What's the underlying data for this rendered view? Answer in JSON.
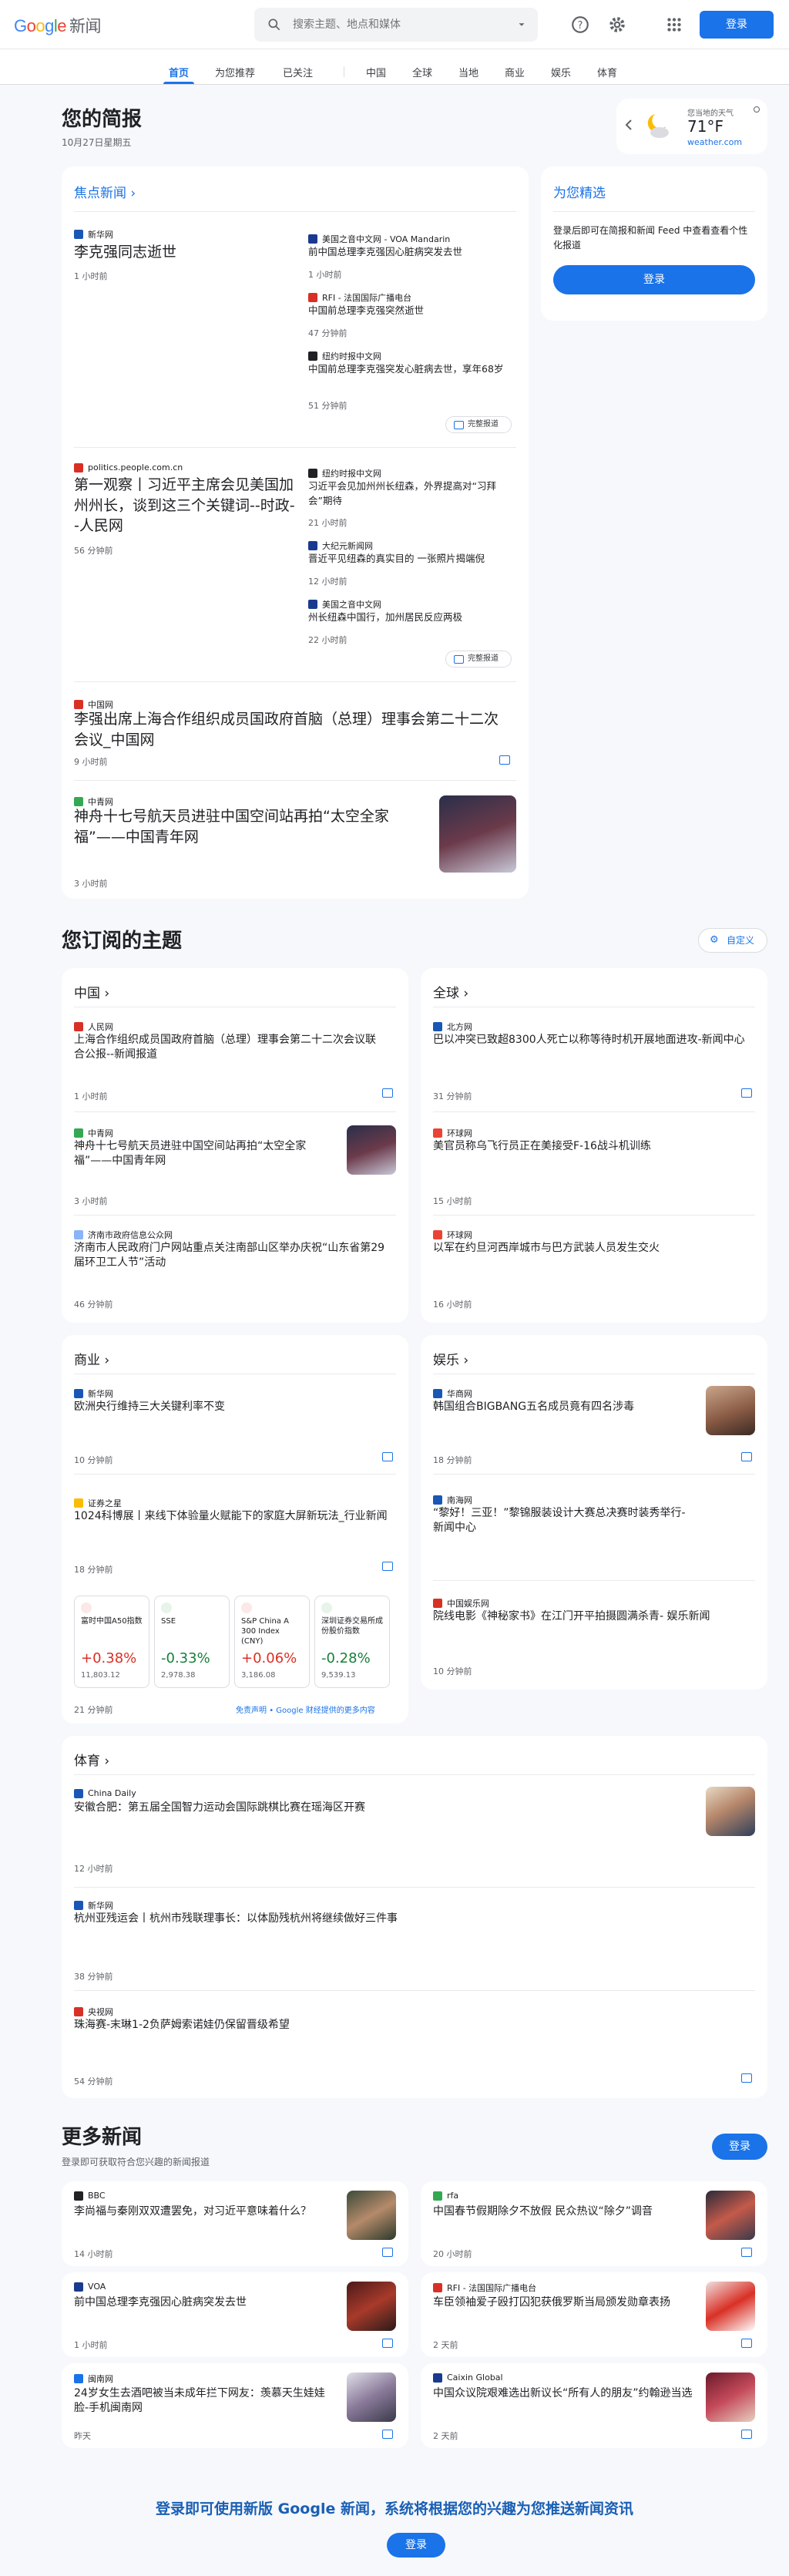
{
  "header": {
    "logo": "Google",
    "app_name": "新闻",
    "search_placeholder": "搜索主题、地点和媒体",
    "signin": "登录"
  },
  "nav": {
    "tabs": [
      "首页",
      "为您推荐",
      "已关注",
      "中国",
      "全球",
      "当地",
      "商业",
      "娱乐",
      "体育"
    ]
  },
  "briefing": {
    "title": "您的简报",
    "date": "10月27日星期五"
  },
  "weather": {
    "label": "您当地的天气",
    "temp": "71°F",
    "source": "weather.com"
  },
  "top": {
    "title": "焦点新闻",
    "full_coverage": "完整报道",
    "cluster1": {
      "main": {
        "source": "新华网",
        "headline": "李克强同志逝世",
        "time": "1 小时前"
      },
      "sides": [
        {
          "source": "美国之音中文网 - VOA Mandarin",
          "headline": "前中国总理李克强因心脏病突发去世",
          "time": "1 小时前"
        },
        {
          "source": "RFI - 法国国际广播电台",
          "headline": "中国前总理李克强突然逝世",
          "time": "47 分钟前"
        },
        {
          "source": "纽约时报中文网",
          "headline": "中国前总理李克强突发心脏病去世，享年68岁",
          "time": "51 分钟前"
        }
      ]
    },
    "cluster2": {
      "main": {
        "source": "politics.people.com.cn",
        "headline": "第一观察丨习近平主席会见美国加州州长，谈到这三个关键词--时政--人民网",
        "time": "56 分钟前"
      },
      "sides": [
        {
          "source": "纽约时报中文网",
          "headline": "习近平会见加州州长纽森，外界提高对“习拜会”期待",
          "time": "21 小时前"
        },
        {
          "source": "大纪元新闻网",
          "headline": "晋近平见纽森的真实目的 一张照片揭端倪",
          "time": "12 小时前"
        },
        {
          "source": "美国之音中文网",
          "headline": "州长纽森中国行，加州居民反应两极",
          "time": "22 小时前"
        }
      ]
    },
    "item3": {
      "source": "中国网",
      "headline": "李强出席上海合作组织成员国政府首脑（总理）理事会第二十二次会议_中国网",
      "time": "9 小时前"
    },
    "item4": {
      "source": "中青网",
      "headline": "神舟十七号航天员进驻中国空间站再拍“太空全家福”——中国青年网",
      "time": "3 小时前"
    }
  },
  "picks": {
    "title": "为您精选",
    "text": "登录后即可在简报和新闻 Feed 中查看查看个性化报道",
    "button": "登录"
  },
  "topics": {
    "title": "您订阅的主题",
    "customize": "自定义",
    "china": {
      "title": "中国",
      "items": [
        {
          "source": "人民网",
          "headline": "上海合作组织成员国政府首脑（总理）理事会第二十二次会议联合公报--新闻报道",
          "time": "1 小时前"
        },
        {
          "source": "中青网",
          "headline": "神舟十七号航天员进驻中国空间站再拍“太空全家福”——中国青年网",
          "time": "3 小时前"
        },
        {
          "source": "济南市政府信息公众网",
          "headline": "济南市人民政府门户网站重点关注南部山区举办庆祝“山东省第29届环卫工人节”活动",
          "time": "46 分钟前"
        }
      ]
    },
    "world": {
      "title": "全球",
      "items": [
        {
          "source": "北方网",
          "headline": "巴以冲突已致超8300人死亡以称等待时机开展地面进攻-新闻中心",
          "time": "31 分钟前"
        },
        {
          "source": "环球网",
          "headline": "美官员称乌飞行员正在美接受F-16战斗机训练",
          "time": "15 小时前"
        },
        {
          "source": "环球网",
          "headline": "以军在约旦河西岸城市与巴方武装人员发生交火",
          "time": "16 小时前"
        }
      ]
    },
    "business": {
      "title": "商业",
      "items": [
        {
          "source": "新华网",
          "headline": "欧洲央行维持三大关键利率不变",
          "time": "10 分钟前"
        },
        {
          "source": "证券之星",
          "headline": "1024科博展丨来线下体验量火赋能下的家庭大屏新玩法_行业新闻",
          "time": "18 分钟前"
        }
      ],
      "stocks": [
        {
          "name": "富时中国A50指数",
          "change": "+0.38%",
          "value": "11,803.12",
          "dir": "up"
        },
        {
          "name": "SSE",
          "change": "-0.33%",
          "value": "2,978.38",
          "dir": "down"
        },
        {
          "name": "S&P China A 300 Index (CNY)",
          "change": "+0.06%",
          "value": "3,186.08",
          "dir": "up"
        },
        {
          "name": "深圳证券交易所成份股价指数",
          "change": "-0.28%",
          "value": "9,539.13",
          "dir": "down"
        }
      ],
      "stocks_time": "21 分钟前",
      "disclaimer": "免责声明",
      "finance_link": "• Google 财经提供的更多内容"
    },
    "entertainment": {
      "title": "娱乐",
      "items": [
        {
          "source": "华商网",
          "headline": "韩国组合BIGBANG五名成员竟有四名涉毒",
          "time": "18 分钟前"
        },
        {
          "source": "南海网",
          "headline": "“黎好！三亚！”黎锦服装设计大赛总决赛时装秀举行-新闻中心",
          "time": "18 分钟前"
        },
        {
          "source": "中国娱乐网",
          "headline": "院线电影《神秘家书》在江门开平拍摄圆满杀青- 娱乐新闻",
          "time": "10 分钟前"
        }
      ]
    },
    "sports": {
      "title": "体育",
      "items": [
        {
          "source": "China Daily",
          "headline": "安徽合肥：第五届全国智力运动会国际跳棋比赛在瑶海区开赛",
          "time": "12 小时前"
        },
        {
          "source": "新华网",
          "headline": "杭州亚残运会丨杭州市残联理事长：以体励残杭州将继续做好三件事",
          "time": "38 分钟前"
        },
        {
          "source": "央视网",
          "headline": "珠海赛-末琳1-2负萨姆索诺娃仍保留晋级希望",
          "time": "54 分钟前"
        }
      ]
    }
  },
  "more": {
    "title": "更多新闻",
    "subtitle": "登录即可获取符合您兴趣的新闻报道",
    "signin": "登录",
    "items": [
      {
        "source": "BBC",
        "headline": "李尚福与秦刚双双遭罢免，对习近平意味着什么？",
        "time": "14 小时前"
      },
      {
        "source": "rfa",
        "headline": "中国春节假期除夕不放假 民众热议“除夕”调音",
        "time": "20 小时前"
      },
      {
        "source": "VOA",
        "headline": "前中国总理李克强因心脏病突发去世",
        "time": "1 小时前"
      },
      {
        "source": "RFI - 法国国际广播电台",
        "headline": "车臣领袖爱子殴打囚犯获俄罗斯当局颁发勋章表扬",
        "time": "2 天前"
      },
      {
        "source": "闽南网",
        "headline": "24岁女生去酒吧被当未成年拦下网友：羡慕天生娃娃脸-手机闽南网",
        "time": "昨天"
      },
      {
        "source": "Caixin Global",
        "headline": "中国众议院艰难选出新议长“所有人的朋友”约翰逊当选",
        "time": "2 天前"
      }
    ]
  },
  "footer": {
    "text": "登录即可使用新版 Google 新闻，系统将根据您的兴趣为您推送新闻资讯",
    "button": "登录"
  }
}
